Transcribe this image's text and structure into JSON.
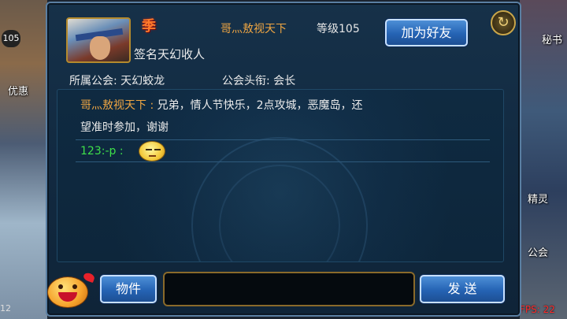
{
  "background": {
    "left_badge": "105",
    "left_label": "优惠",
    "left_bottom": "12",
    "right_labels": [
      "秘书",
      "精灵",
      "公会"
    ],
    "fps": "FPS: 22"
  },
  "profile": {
    "vip_emblem": "季",
    "player_name": "哥灬敖视天下",
    "level": "等级105",
    "signature": "签名天幻收人",
    "guild": "所属公会: 天幻蛟龙",
    "guild_title": "公会头衔: 会长",
    "add_friend_label": "加为好友",
    "close_icon": "close-icon"
  },
  "chat": {
    "messages": [
      {
        "sender": "哥灬敖视天下 :",
        "text": " 兄弟，情人节快乐，2点攻城，恶魔岛，还",
        "continuation": "望准时参加，谢谢"
      },
      {
        "sender": "123:-p :",
        "text": "",
        "emoticon": "smiley-icon"
      }
    ]
  },
  "footer": {
    "emoji_icon": "emoji-face-icon",
    "items_label": "物件",
    "input_value": "",
    "input_placeholder": "",
    "send_label": "发 送"
  },
  "colors": {
    "name_orange": "#f0a642",
    "sender_green": "#3ee04a",
    "button_blue": "#2563b4",
    "fps_red": "#ff2a2a"
  }
}
